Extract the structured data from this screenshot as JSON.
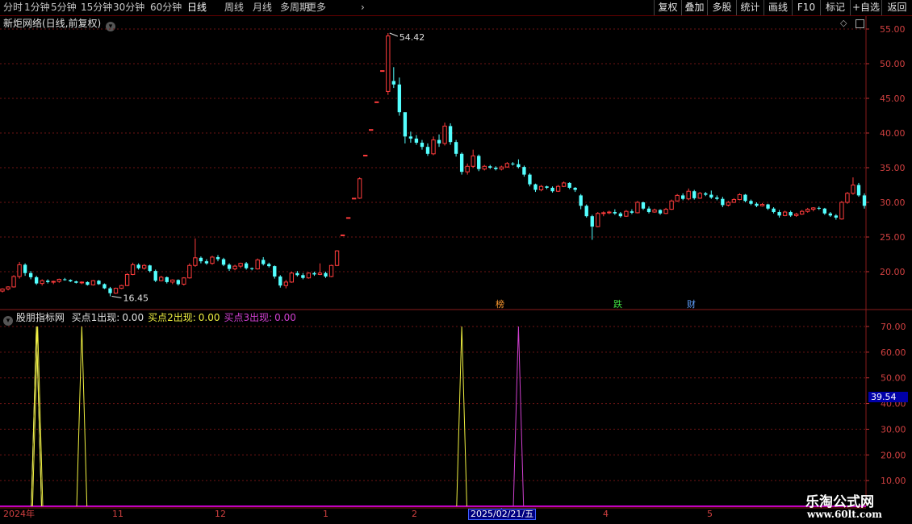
{
  "toolbar": {
    "left": [
      "分时",
      "1分钟",
      "5分钟",
      "15分钟",
      "30分钟",
      "60分钟",
      "日线",
      "周线",
      "月线",
      "多周期",
      "更多"
    ],
    "active": "日线",
    "right": [
      "复权",
      "叠加",
      "多股",
      "统计",
      "画线",
      "F10",
      "标记",
      "+自选",
      "返回"
    ]
  },
  "main_panel": {
    "title": "新炬网络(日线,前复权)",
    "high_label": "54.42",
    "low_label": "16.45",
    "badges": [
      "榜",
      "跌",
      "财"
    ]
  },
  "indicator_panel": {
    "name": "股朋指标网",
    "items": [
      {
        "label": "买点1出现:",
        "value": "0.00",
        "color": "#e0e0e0"
      },
      {
        "label": "买点2出现:",
        "value": "0.00",
        "color": "#f0f040"
      },
      {
        "label": "买点3出现:",
        "value": "0.00",
        "color": "#d040d0"
      }
    ],
    "current_value": "39.54"
  },
  "time_axis": {
    "labels": [
      "2024年",
      "11",
      "12",
      "1",
      "2",
      "4",
      "5"
    ],
    "cursor_date": "2025/02/21/五"
  },
  "watermark": {
    "line1": "乐淘公式网",
    "line2": "www.60lt.com"
  },
  "chart_data": [
    {
      "type": "candlestick",
      "title": "新炬网络(日线,前复权)",
      "y_ticks": [
        20.0,
        25.0,
        30.0,
        35.0,
        40.0,
        45.0,
        50.0,
        55.0
      ],
      "ylim": [
        16.0,
        56.0
      ],
      "annotations": [
        {
          "text": "54.42",
          "kind": "high"
        },
        {
          "text": "16.45",
          "kind": "low"
        }
      ],
      "colors": {
        "up": "#ff3c3c",
        "down": "#54ffff",
        "grid": "#6e1414"
      },
      "candles": [
        [
          17.2,
          17.6,
          17.0,
          17.5
        ],
        [
          17.5,
          17.9,
          17.3,
          17.8
        ],
        [
          17.8,
          19.5,
          17.7,
          19.3
        ],
        [
          19.3,
          21.4,
          19.0,
          21.0
        ],
        [
          21.0,
          21.2,
          19.4,
          19.8
        ],
        [
          19.8,
          20.1,
          18.9,
          19.2
        ],
        [
          19.2,
          19.4,
          18.1,
          18.3
        ],
        [
          18.3,
          18.9,
          18.0,
          18.7
        ],
        [
          18.7,
          18.9,
          18.3,
          18.5
        ],
        [
          18.5,
          18.7,
          18.2,
          18.6
        ],
        [
          18.6,
          19.0,
          18.4,
          18.9
        ],
        [
          18.9,
          19.1,
          18.7,
          18.8
        ],
        [
          18.8,
          18.9,
          18.5,
          18.6
        ],
        [
          18.6,
          18.7,
          18.3,
          18.4
        ],
        [
          18.4,
          18.6,
          18.2,
          18.5
        ],
        [
          18.5,
          18.6,
          18.0,
          18.1
        ],
        [
          18.1,
          18.8,
          18.0,
          18.7
        ],
        [
          18.7,
          18.8,
          18.1,
          18.2
        ],
        [
          18.2,
          18.3,
          17.5,
          17.6
        ],
        [
          17.6,
          17.8,
          16.45,
          16.9
        ],
        [
          16.9,
          17.7,
          16.8,
          17.6
        ],
        [
          17.6,
          18.1,
          17.5,
          18.0
        ],
        [
          18.0,
          19.8,
          17.9,
          19.6
        ],
        [
          19.6,
          21.3,
          19.5,
          21.0
        ],
        [
          21.0,
          21.2,
          20.3,
          20.5
        ],
        [
          20.5,
          21.1,
          20.3,
          20.9
        ],
        [
          20.9,
          21.0,
          19.9,
          20.1
        ],
        [
          20.1,
          20.3,
          18.5,
          18.7
        ],
        [
          18.7,
          19.4,
          18.6,
          19.2
        ],
        [
          19.2,
          19.3,
          18.3,
          18.5
        ],
        [
          18.5,
          18.9,
          18.2,
          18.8
        ],
        [
          18.8,
          18.9,
          18.0,
          18.2
        ],
        [
          18.2,
          19.2,
          18.0,
          19.1
        ],
        [
          19.1,
          21.2,
          19.0,
          20.9
        ],
        [
          20.9,
          24.8,
          20.7,
          22.0
        ],
        [
          22.0,
          22.2,
          21.2,
          21.5
        ],
        [
          21.5,
          21.8,
          21.0,
          21.2
        ],
        [
          21.2,
          22.3,
          21.0,
          22.1
        ],
        [
          22.1,
          22.4,
          21.5,
          21.8
        ],
        [
          21.8,
          22.0,
          20.8,
          21.0
        ],
        [
          21.0,
          21.2,
          20.1,
          20.4
        ],
        [
          20.4,
          21.0,
          20.2,
          20.8
        ],
        [
          20.8,
          21.3,
          20.5,
          21.2
        ],
        [
          21.2,
          21.4,
          20.3,
          20.5
        ],
        [
          20.5,
          20.6,
          20.2,
          20.4
        ],
        [
          20.4,
          21.9,
          20.3,
          21.7
        ],
        [
          21.7,
          22.1,
          20.9,
          21.1
        ],
        [
          21.1,
          21.3,
          20.6,
          20.8
        ],
        [
          20.8,
          20.9,
          19.0,
          19.3
        ],
        [
          19.3,
          19.5,
          17.7,
          18.0
        ],
        [
          18.0,
          18.8,
          17.6,
          18.5
        ],
        [
          18.5,
          20.0,
          18.4,
          19.8
        ],
        [
          19.8,
          20.1,
          19.3,
          19.5
        ],
        [
          19.5,
          19.8,
          18.9,
          19.1
        ],
        [
          19.1,
          19.9,
          19.0,
          19.8
        ],
        [
          19.8,
          20.0,
          19.4,
          19.6
        ],
        [
          19.6,
          21.2,
          19.5,
          19.8
        ],
        [
          19.8,
          20.0,
          19.1,
          19.3
        ],
        [
          19.3,
          21.0,
          19.2,
          20.9
        ],
        [
          20.9,
          23.1,
          20.8,
          23.0
        ],
        [
          25.3,
          25.3,
          25.3,
          25.3
        ],
        [
          27.8,
          27.8,
          27.8,
          27.8
        ],
        [
          30.6,
          30.6,
          30.6,
          30.6
        ],
        [
          30.6,
          33.6,
          30.5,
          33.4
        ],
        [
          36.8,
          36.8,
          36.8,
          36.8
        ],
        [
          40.5,
          40.5,
          40.5,
          40.5
        ],
        [
          44.5,
          44.5,
          44.5,
          44.5
        ],
        [
          49.0,
          49.0,
          49.0,
          49.0
        ],
        [
          46.0,
          54.42,
          45.5,
          54.0
        ],
        [
          47.5,
          49.5,
          46.5,
          47.0
        ],
        [
          47.0,
          48.0,
          42.5,
          43.0
        ],
        [
          43.0,
          42.0,
          38.5,
          39.5
        ],
        [
          39.5,
          40.2,
          38.6,
          39.2
        ],
        [
          39.2,
          39.7,
          38.3,
          38.6
        ],
        [
          38.6,
          39.0,
          37.6,
          38.0
        ],
        [
          38.0,
          38.5,
          36.7,
          37.0
        ],
        [
          37.0,
          39.5,
          36.8,
          39.0
        ],
        [
          39.0,
          39.8,
          38.0,
          38.5
        ],
        [
          38.5,
          41.5,
          38.2,
          41.0
        ],
        [
          41.0,
          41.4,
          38.3,
          38.7
        ],
        [
          38.7,
          39.0,
          36.6,
          37.0
        ],
        [
          37.0,
          37.2,
          34.0,
          34.4
        ],
        [
          34.4,
          35.6,
          34.0,
          35.2
        ],
        [
          35.2,
          37.6,
          35.0,
          36.7
        ],
        [
          36.7,
          36.9,
          34.5,
          34.8
        ],
        [
          34.8,
          35.4,
          34.6,
          35.2
        ],
        [
          35.2,
          35.4,
          34.8,
          35.0
        ],
        [
          35.0,
          35.2,
          34.6,
          34.8
        ],
        [
          34.8,
          35.3,
          34.6,
          35.1
        ],
        [
          35.1,
          35.8,
          35.0,
          35.6
        ],
        [
          35.6,
          35.8,
          35.3,
          35.5
        ],
        [
          35.5,
          36.2,
          34.9,
          35.1
        ],
        [
          35.1,
          35.3,
          33.7,
          34.0
        ],
        [
          34.0,
          34.2,
          32.3,
          32.6
        ],
        [
          32.6,
          32.7,
          31.5,
          31.8
        ],
        [
          31.8,
          32.5,
          31.6,
          32.3
        ],
        [
          32.3,
          32.4,
          31.9,
          32.1
        ],
        [
          32.1,
          32.3,
          31.4,
          31.6
        ],
        [
          31.6,
          32.5,
          31.5,
          32.3
        ],
        [
          32.3,
          33.0,
          32.2,
          32.8
        ],
        [
          32.8,
          32.9,
          31.9,
          32.1
        ],
        [
          32.1,
          32.2,
          31.5,
          31.8
        ],
        [
          31.0,
          31.2,
          29.0,
          29.5
        ],
        [
          29.5,
          29.7,
          27.8,
          28.0
        ],
        [
          28.0,
          28.2,
          24.6,
          26.5
        ],
        [
          26.5,
          28.6,
          26.4,
          28.4
        ],
        [
          28.4,
          28.7,
          28.0,
          28.5
        ],
        [
          28.5,
          28.8,
          28.3,
          28.6
        ],
        [
          28.6,
          29.0,
          28.2,
          28.4
        ],
        [
          28.4,
          28.6,
          27.8,
          28.0
        ],
        [
          28.0,
          28.9,
          27.9,
          28.7
        ],
        [
          28.7,
          29.0,
          28.3,
          28.5
        ],
        [
          28.5,
          30.2,
          28.4,
          30.0
        ],
        [
          30.0,
          30.1,
          28.9,
          29.1
        ],
        [
          29.1,
          29.4,
          28.4,
          28.6
        ],
        [
          28.6,
          29.1,
          28.5,
          28.9
        ],
        [
          28.9,
          29.0,
          28.2,
          28.4
        ],
        [
          28.4,
          29.2,
          28.3,
          29.0
        ],
        [
          29.0,
          30.4,
          28.9,
          30.2
        ],
        [
          30.2,
          31.2,
          30.1,
          31.0
        ],
        [
          31.0,
          31.3,
          30.3,
          30.5
        ],
        [
          30.5,
          32.0,
          30.3,
          31.6
        ],
        [
          31.6,
          31.8,
          30.4,
          30.6
        ],
        [
          30.6,
          31.5,
          30.5,
          31.3
        ],
        [
          31.3,
          31.5,
          30.9,
          31.1
        ],
        [
          31.1,
          31.7,
          30.5,
          30.7
        ],
        [
          30.7,
          31.0,
          30.3,
          30.5
        ],
        [
          30.5,
          30.8,
          29.3,
          29.6
        ],
        [
          29.6,
          30.2,
          29.4,
          30.0
        ],
        [
          30.0,
          30.6,
          29.9,
          30.4
        ],
        [
          30.4,
          31.3,
          30.3,
          31.1
        ],
        [
          31.1,
          31.2,
          30.0,
          30.2
        ],
        [
          30.2,
          30.4,
          29.6,
          29.8
        ],
        [
          29.8,
          30.0,
          29.3,
          29.5
        ],
        [
          29.5,
          29.9,
          29.4,
          29.7
        ],
        [
          29.7,
          29.8,
          28.9,
          29.1
        ],
        [
          29.1,
          29.3,
          28.4,
          28.6
        ],
        [
          28.6,
          28.9,
          27.8,
          28.1
        ],
        [
          28.1,
          28.8,
          28.0,
          28.6
        ],
        [
          28.6,
          28.8,
          27.9,
          28.1
        ],
        [
          28.1,
          28.5,
          27.9,
          28.3
        ],
        [
          28.3,
          28.9,
          28.2,
          28.7
        ],
        [
          28.7,
          29.2,
          28.5,
          29.0
        ],
        [
          29.0,
          29.3,
          28.7,
          29.2
        ],
        [
          29.2,
          29.4,
          28.9,
          29.1
        ],
        [
          29.1,
          29.2,
          28.2,
          28.4
        ],
        [
          28.4,
          28.6,
          27.9,
          28.1
        ],
        [
          28.1,
          28.3,
          27.5,
          27.8
        ],
        [
          27.6,
          30.2,
          27.5,
          30.0
        ],
        [
          30.0,
          31.5,
          29.8,
          31.3
        ],
        [
          31.3,
          33.6,
          31.1,
          32.5
        ],
        [
          32.5,
          32.8,
          30.8,
          31.0
        ],
        [
          31.0,
          31.3,
          29.1,
          29.5
        ]
      ]
    },
    {
      "type": "line",
      "title": "股朋指标网",
      "y_ticks": [
        10.0,
        20.0,
        30.0,
        40.0,
        50.0,
        60.0,
        70.0
      ],
      "ylim": [
        0,
        75
      ],
      "grid": true,
      "series": [
        {
          "name": "买点1出现",
          "color": "#e0e0e0",
          "spikes": [
            {
              "index": 6,
              "value": 70
            }
          ]
        },
        {
          "name": "买点2出现",
          "color": "#f0f040",
          "spikes": [
            {
              "index": 6,
              "value": 70
            },
            {
              "index": 14,
              "value": 70
            },
            {
              "index": 81,
              "value": 70
            }
          ]
        },
        {
          "name": "买点3出现",
          "color": "#d040d0",
          "spikes": [
            {
              "index": 91,
              "value": 70
            }
          ]
        }
      ]
    }
  ]
}
